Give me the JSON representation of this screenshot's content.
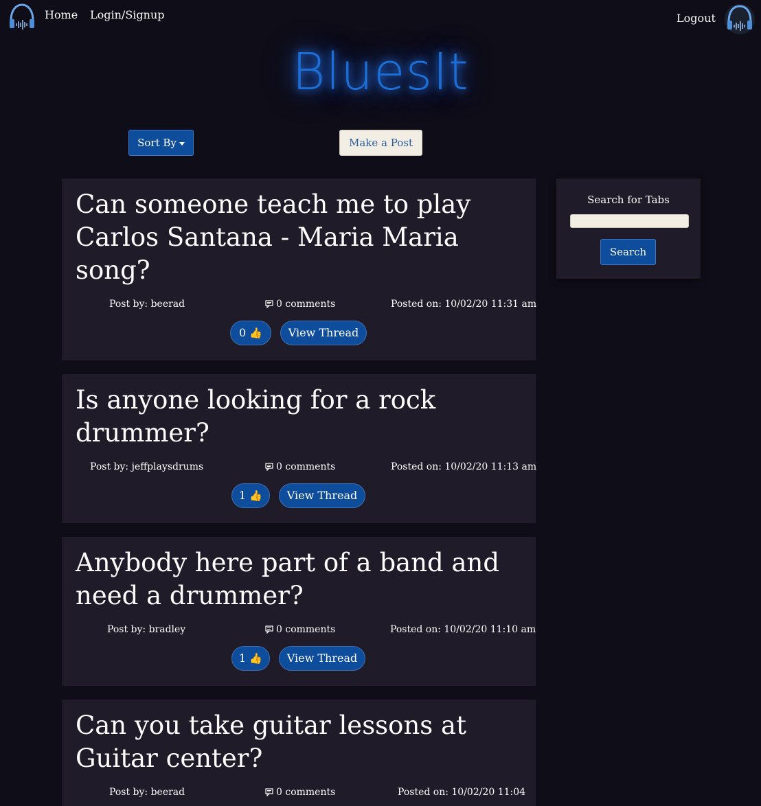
{
  "nav": {
    "home": "Home",
    "login": "Login/Signup",
    "logout": "Logout"
  },
  "brand": {
    "title": "BluesIt"
  },
  "actions": {
    "sort": "Sort By",
    "make_post": "Make a Post"
  },
  "posts": [
    {
      "title": "Can someone teach me to play Carlos Santana - Maria Maria song?",
      "author": "Post by: beerad",
      "comments": "0 comments",
      "posted": "Posted on: 10/02/20 11:31 am",
      "likes": "0",
      "view": "View Thread"
    },
    {
      "title": "Is anyone looking for a rock drummer?",
      "author": "Post by: jeffplaysdrums",
      "comments": "0 comments",
      "posted": "Posted on: 10/02/20 11:13 am",
      "likes": "1",
      "view": "View Thread"
    },
    {
      "title": "Anybody here part of a band and need a drummer?",
      "author": "Post by: bradley",
      "comments": "0 comments",
      "posted": "Posted on: 10/02/20 11:10 am",
      "likes": "1",
      "view": "View Thread"
    },
    {
      "title": "Can you take guitar lessons at Guitar center?",
      "author": "Post by: beerad",
      "comments": "0 comments",
      "posted": "Posted on: 10/02/20 11:04",
      "likes": "",
      "view": ""
    }
  ],
  "sidebar": {
    "title": "Search for Tabs",
    "search_value": "",
    "search_button": "Search"
  },
  "icons": {
    "logo": "headphones-icon",
    "comment": "comment-icon",
    "like": "thumbs-up-icon"
  },
  "colors": {
    "background": "#0f0d17",
    "card": "#1f1b28",
    "accent": "#0d4d9c",
    "brand_glow": "#1c6fd6"
  }
}
